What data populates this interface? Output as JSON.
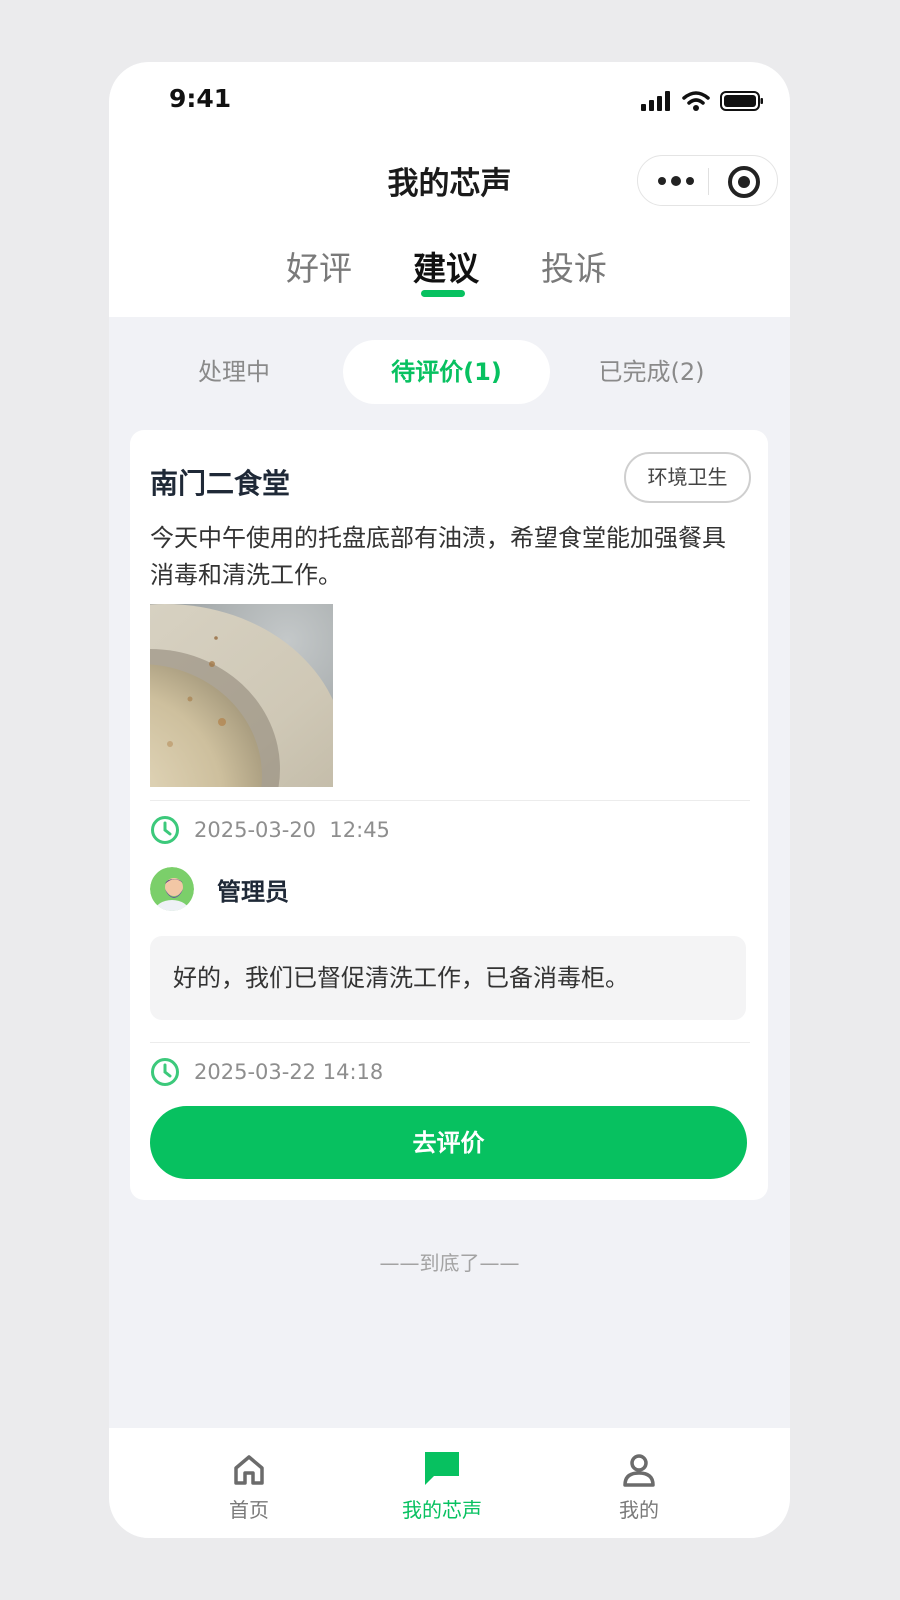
{
  "status_bar": {
    "time": "9:41"
  },
  "nav": {
    "title": "我的芯声"
  },
  "tabs": [
    {
      "label": "好评"
    },
    {
      "label": "建议"
    },
    {
      "label": "投诉"
    }
  ],
  "segments": [
    {
      "label": "处理中"
    },
    {
      "label": "待评价(1)"
    },
    {
      "label": "已完成(2)"
    }
  ],
  "card": {
    "place": "南门二食堂",
    "tag": "环境卫生",
    "description": "今天中午使用的托盘底部有油渍，希望食堂能加强餐具消毒和清洗工作。",
    "time1": "2025-03-20  12:45",
    "admin_name": "管理员",
    "reply": "好的，我们已督促清洗工作，已备消毒柜。",
    "time2": "2025-03-22 14:18",
    "action_label": "去评价"
  },
  "end_note": "——到底了——",
  "tabbar": [
    {
      "label": "首页",
      "icon": "home-icon"
    },
    {
      "label": "我的芯声",
      "icon": "chat-icon"
    },
    {
      "label": "我的",
      "icon": "user-icon"
    }
  ],
  "colors": {
    "accent": "#07c160",
    "background": "#f1f2f6"
  }
}
